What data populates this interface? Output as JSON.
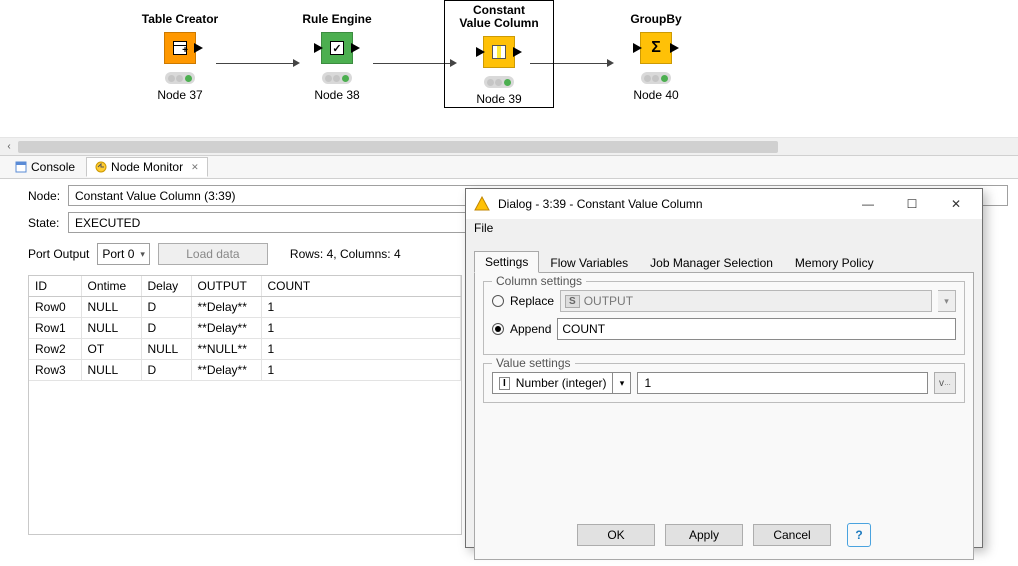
{
  "workflow": {
    "nodes": [
      {
        "title": "Table Creator",
        "id": "Node 37",
        "color": "c-orange"
      },
      {
        "title": "Rule Engine",
        "id": "Node 38",
        "color": "c-green"
      },
      {
        "title": "Constant\nValue Column",
        "id": "Node 39",
        "color": "c-yellow",
        "selected": true
      },
      {
        "title": "GroupBy",
        "id": "Node 40",
        "color": "c-yellow"
      }
    ]
  },
  "tabs": {
    "console": "Console",
    "node_monitor": "Node Monitor"
  },
  "monitor": {
    "node_label": "Node:",
    "node_value": "Constant Value Column  (3:39)",
    "state_label": "State:",
    "state_value": "EXECUTED",
    "port_label": "Port Output",
    "port_value": "Port 0",
    "load_btn": "Load data",
    "rows_text": "Rows: 4, Columns: 4",
    "columns": [
      "ID",
      "Ontime",
      "Delay",
      "OUTPUT",
      "COUNT"
    ],
    "rows": [
      [
        "Row0",
        "NULL",
        "D",
        "**Delay**",
        "1"
      ],
      [
        "Row1",
        "NULL",
        "D",
        "**Delay**",
        "1"
      ],
      [
        "Row2",
        "OT",
        "NULL",
        "**NULL**",
        "1"
      ],
      [
        "Row3",
        "NULL",
        "D",
        "**Delay**",
        "1"
      ]
    ]
  },
  "dialog": {
    "title": "Dialog - 3:39 - Constant Value Column",
    "menu_file": "File",
    "tabs": [
      "Settings",
      "Flow Variables",
      "Job Manager Selection",
      "Memory Policy"
    ],
    "column_settings": {
      "legend": "Column settings",
      "replace_label": "Replace",
      "replace_value": "OUTPUT",
      "append_label": "Append",
      "append_value": "COUNT"
    },
    "value_settings": {
      "legend": "Value settings",
      "type": "Number (integer)",
      "value": "1"
    },
    "buttons": {
      "ok": "OK",
      "apply": "Apply",
      "cancel": "Cancel"
    }
  }
}
